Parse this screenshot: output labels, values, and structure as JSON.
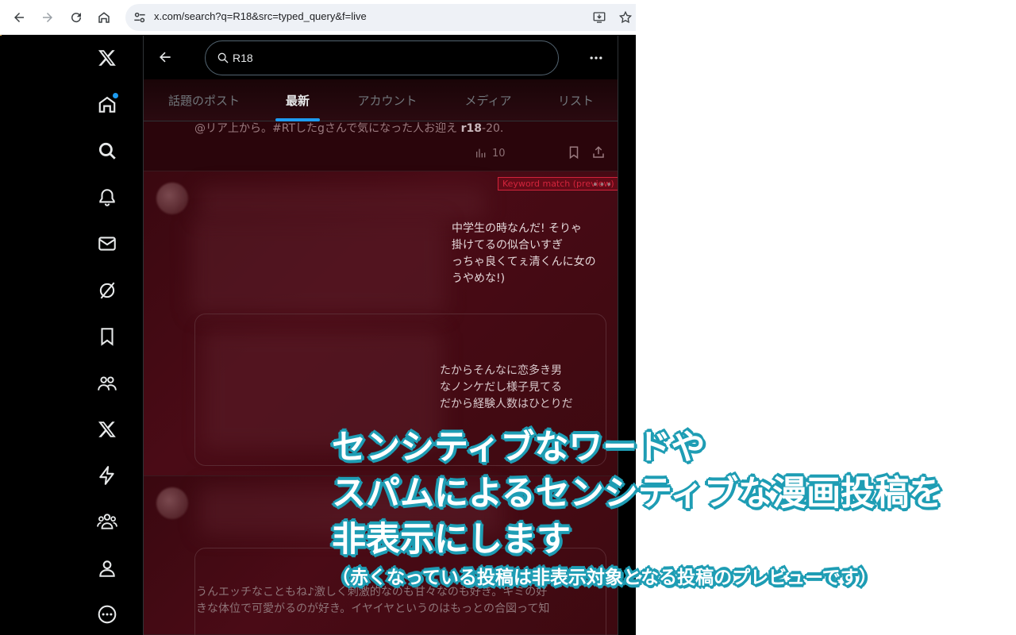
{
  "browser": {
    "url": "x.com/search?q=R18&src=typed_query&f=live",
    "icons": [
      "back-icon",
      "forward-icon",
      "reload-icon",
      "home-icon",
      "site-settings-icon",
      "install-app-icon",
      "star-icon"
    ]
  },
  "search": {
    "query": "R18"
  },
  "tabs": [
    {
      "label": "話題のポスト"
    },
    {
      "label": "最新"
    },
    {
      "label": "アカウント"
    },
    {
      "label": "メディア"
    },
    {
      "label": "リスト"
    }
  ],
  "feed": {
    "top_post": {
      "tail_text_before": "@リア上から。#RTしたgさんで気になった人お迎え ",
      "tail_keyword": "r18",
      "tail_text_after": "-20.",
      "views": "10"
    },
    "post1": {
      "badge": "Keyword match (preview)",
      "more": "•••",
      "lines": [
        "中学生の時なんだ! そりゃ",
        "掛けてるの似合いすぎ",
        "っちゃ良くてぇ清くんに女の",
        "うやめな!)"
      ],
      "quote_lines": [
        "たからそんなに恋多き男",
        "なノンケだし様子見てる",
        "だから経験人数はひとりだ"
      ]
    },
    "post2": {
      "lines": [
        "うんエッチなこともね♪激しく刺激的なのも甘々なのも好き。キミの好",
        "きな体位で可愛がるのが好き。イヤイヤというのはもっとの合図って知"
      ]
    }
  },
  "caption": {
    "line1": "センシティブなワードや",
    "line2": "スパムによるセンシティブな漫画投稿を",
    "line3": "非表示にします",
    "line4": "（赤くなっている投稿は非表示対象となる投稿のプレビューです）"
  },
  "colors": {
    "accent": "#1d9bf0",
    "caption_outline": "#1e9db4",
    "hidden_post_tint": "#4a0b16",
    "keyword_badge": "#d2243c"
  }
}
